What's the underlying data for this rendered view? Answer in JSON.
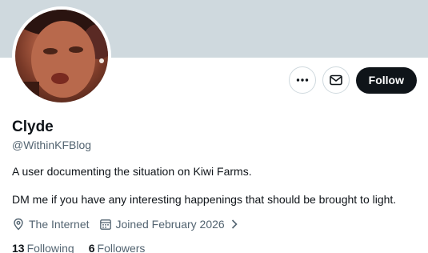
{
  "profile": {
    "name": "Clyde",
    "handle": "@WithinKFBlog",
    "bio_line1": "A user documenting the situation on Kiwi Farms.",
    "bio_line2": "DM me if you have any interesting happenings that should be brought to light.",
    "location": "The Internet",
    "joined": "Joined February 2026"
  },
  "stats": {
    "following_count": "13",
    "following_label": "Following",
    "followers_count": "6",
    "followers_label": "Followers"
  },
  "actions": {
    "follow_label": "Follow",
    "more_icon": "more-horizontal-icon",
    "message_icon": "envelope-icon"
  },
  "colors": {
    "banner": "#cfd9de",
    "primary_text": "#0f1419",
    "secondary_text": "#536471",
    "follow_button_bg": "#0f1419"
  }
}
